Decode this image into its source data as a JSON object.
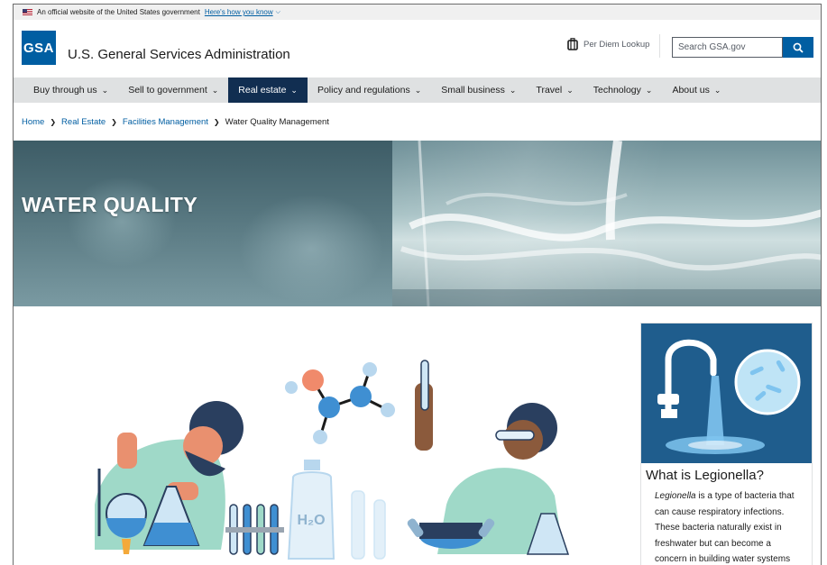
{
  "banner": {
    "text": "An official website of the United States government",
    "link": "Here's how you know"
  },
  "header": {
    "logo": "GSA",
    "agency": "U.S. General Services Administration",
    "per_diem": "Per Diem Lookup",
    "search_placeholder": "Search GSA.gov"
  },
  "nav": {
    "items": [
      {
        "label": "Buy through us"
      },
      {
        "label": "Sell to government"
      },
      {
        "label": "Real estate",
        "active": true
      },
      {
        "label": "Policy and regulations"
      },
      {
        "label": "Small business"
      },
      {
        "label": "Travel"
      },
      {
        "label": "Technology"
      },
      {
        "label": "About us"
      }
    ]
  },
  "breadcrumb": {
    "items": [
      "Home",
      "Real Estate",
      "Facilities Management"
    ],
    "current": "Water Quality Management"
  },
  "hero": {
    "title": "WATER QUALITY"
  },
  "illustration": {
    "bottle_label": "H₂O"
  },
  "card": {
    "title": "What is Legionella?",
    "body_em": "Legionella",
    "body": " is a type of bacteria that can cause respiratory infections. These bacteria naturally exist in freshwater but can become a concern in building water systems"
  },
  "colors": {
    "primary": "#005ea2",
    "nav_active": "#112e51",
    "nav_bg": "#dfe1e2",
    "card_image_bg": "#1f5d8d"
  }
}
